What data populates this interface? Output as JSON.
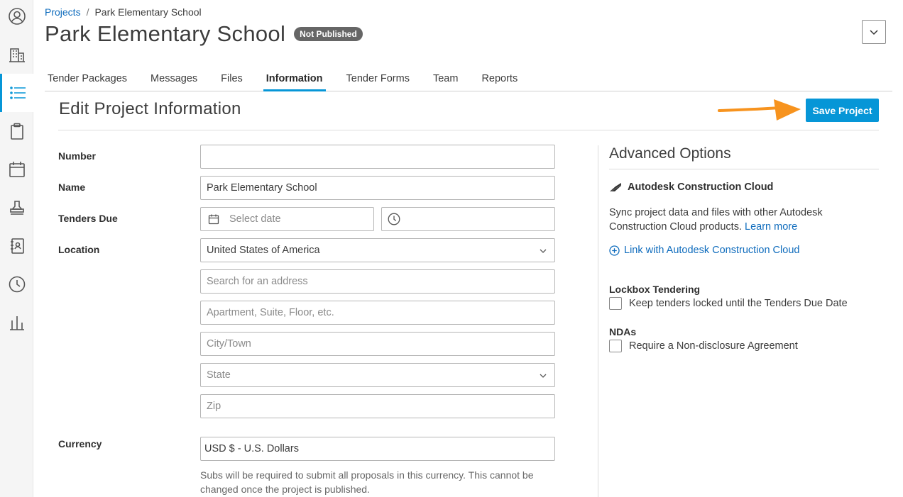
{
  "breadcrumb": {
    "root": "Projects",
    "separator": "/",
    "current": "Park Elementary School"
  },
  "header": {
    "title": "Park Elementary School",
    "status_badge": "Not Published"
  },
  "tabs": [
    {
      "label": "Tender Packages"
    },
    {
      "label": "Messages"
    },
    {
      "label": "Files"
    },
    {
      "label": "Information",
      "active": true
    },
    {
      "label": "Tender Forms"
    },
    {
      "label": "Team"
    },
    {
      "label": "Reports"
    }
  ],
  "section": {
    "title": "Edit Project Information",
    "save_label": "Save Project"
  },
  "form": {
    "number": {
      "label": "Number",
      "value": ""
    },
    "name": {
      "label": "Name",
      "value": "Park Elementary School"
    },
    "tenders_due": {
      "label": "Tenders Due",
      "date_placeholder": "Select date",
      "time_value": ""
    },
    "location": {
      "label": "Location",
      "country": "United States of America",
      "address_placeholder": "Search for an address",
      "apartment_placeholder": "Apartment, Suite, Floor, etc.",
      "city_placeholder": "City/Town",
      "state_placeholder": "State",
      "zip_placeholder": "Zip"
    },
    "currency": {
      "label": "Currency",
      "value": "USD $ - U.S. Dollars",
      "help": "Subs will be required to submit all proposals in this currency. This cannot be changed once the project is published."
    }
  },
  "advanced": {
    "title": "Advanced Options",
    "acc_title": "Autodesk Construction Cloud",
    "sync_text": "Sync project data and files with other Autodesk Construction Cloud products.",
    "learn_more": "Learn more",
    "link_label": "Link with Autodesk Construction Cloud",
    "lockbox": {
      "title": "Lockbox Tendering",
      "option": "Keep tenders locked until the Tenders Due Date",
      "checked": false
    },
    "ndas": {
      "title": "NDAs",
      "option": "Require a Non-disclosure Agreement",
      "checked": false
    }
  },
  "colors": {
    "accent": "#0696d7",
    "link": "#0f6cbd",
    "badge": "#666666",
    "arrow": "#f7931e"
  },
  "rail_icons": [
    "user-circle-icon",
    "building-icon",
    "list-icon",
    "clipboard-icon",
    "calendar-icon",
    "stamp-icon",
    "address-book-icon",
    "clock-icon",
    "bar-chart-icon"
  ]
}
